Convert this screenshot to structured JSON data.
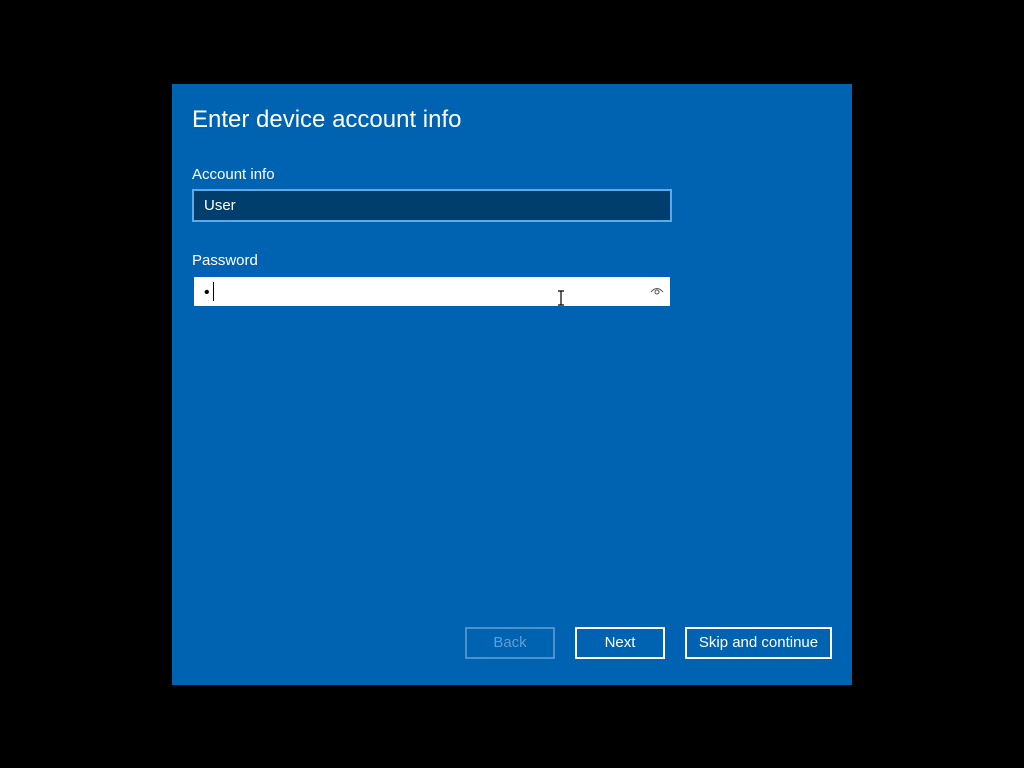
{
  "dialog": {
    "title": "Enter device account info"
  },
  "account": {
    "label": "Account info",
    "value": "User"
  },
  "password": {
    "label": "Password",
    "masked_value": "•",
    "reveal_icon": "eye-icon"
  },
  "buttons": {
    "back": "Back",
    "next": "Next",
    "skip": "Skip and continue"
  },
  "colors": {
    "dialog_background": "#0063b1",
    "screen_background": "#000000",
    "account_field_background": "#003e6e",
    "account_field_border": "#5fa9e6",
    "disabled_button": "#4d92ca"
  }
}
